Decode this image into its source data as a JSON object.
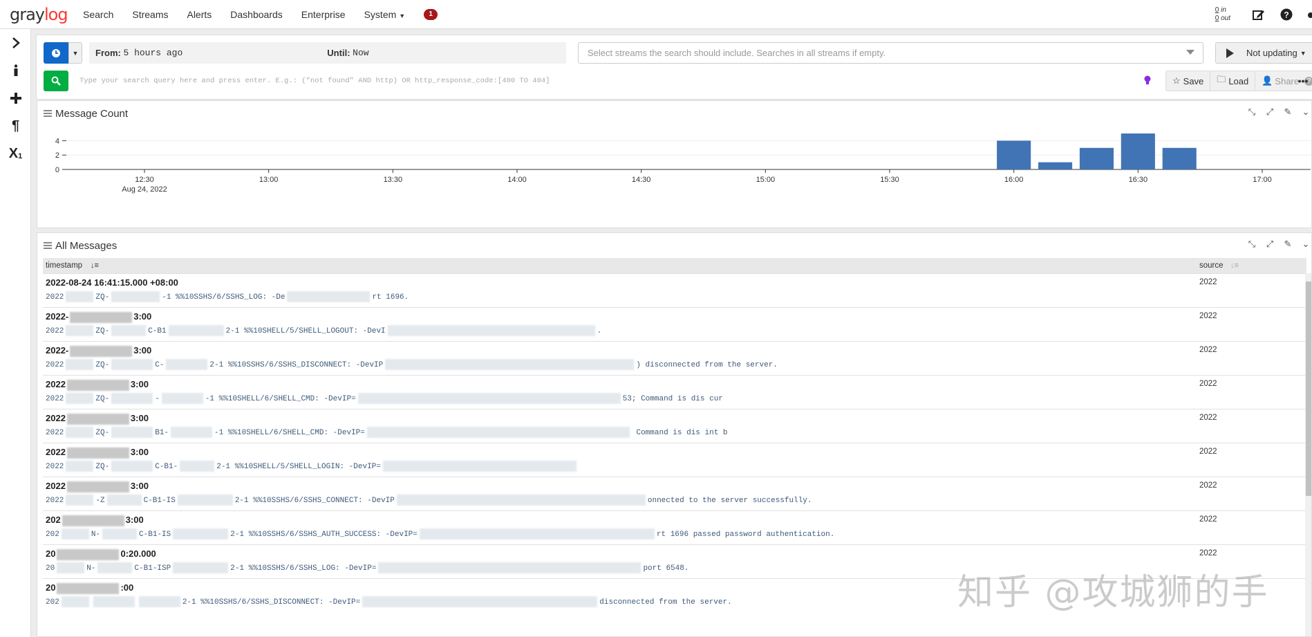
{
  "nav": {
    "logo_main": "gray",
    "logo_accent": "log",
    "items": [
      "Search",
      "Streams",
      "Alerts",
      "Dashboards",
      "Enterprise",
      "System"
    ],
    "notification_count": "1",
    "throughput_in_value": "0",
    "throughput_in_label": "in",
    "throughput_out_value": "0",
    "throughput_out_label": "out"
  },
  "search": {
    "from_label": "From",
    "from_value": "5 hours ago",
    "until_label": "Until",
    "until_value": "Now",
    "streams_placeholder": "Select streams the search should include. Searches in all streams if empty.",
    "refresh_label": "Not updating",
    "query_placeholder": "Type your search query here and press enter. E.g.: (\"not found\" AND http) OR http_response_code:[400 TO 404]",
    "save_label": "Save",
    "load_label": "Load",
    "share_label": "Share"
  },
  "message_count": {
    "title": "Message Count"
  },
  "chart_data": {
    "type": "bar",
    "ylim": [
      0,
      5
    ],
    "yticks": [
      "0",
      "2",
      "4"
    ],
    "xticks": [
      "12:30",
      "13:00",
      "13:30",
      "14:00",
      "14:30",
      "15:00",
      "15:30",
      "16:00",
      "16:30",
      "17:00"
    ],
    "x_date_label": "Aug 24, 2022",
    "bars": [
      {
        "x": "16:00",
        "value": 4
      },
      {
        "x": "16:10",
        "value": 1
      },
      {
        "x": "16:20",
        "value": 3
      },
      {
        "x": "16:30",
        "value": 5
      },
      {
        "x": "16:40",
        "value": 3
      }
    ],
    "bar_color": "#4174b4",
    "grid": true
  },
  "messages": {
    "title": "All Messages",
    "col_timestamp": "timestamp",
    "col_source": "source",
    "rows": [
      {
        "ts": "2022-08-24 16:41:15.000 +08:00",
        "ts_tail": "",
        "p1": "2022",
        "p2": "ZQ-",
        "p3": "-1 %%10SSHS/6/SSHS_LOG: -De",
        "p4": "rt 1696.",
        "source": "2022"
      },
      {
        "ts": "2022-",
        "ts_tail": "3:00",
        "p1": "2022",
        "p2": "ZQ-",
        "p3": "C-B1",
        "p4": "2-1 %%10SHELL/5/SHELL_LOGOUT: -DevI",
        "p5": ".",
        "source": "2022"
      },
      {
        "ts": "2022-",
        "ts_tail": "3:00",
        "p1": "2022",
        "p2": "ZQ-",
        "p3": "C-",
        "p4": "2-1 %%10SSHS/6/SSHS_DISCONNECT: -DevIP",
        "p5": ") disconnected from the server.",
        "source": "2022"
      },
      {
        "ts": "2022",
        "ts_tail": "3:00",
        "p1": "2022",
        "p2": "ZQ-",
        "p3": "-",
        "p4": "-1 %%10SHELL/6/SHELL_CMD: -DevIP=",
        "p5": "53; Command is dis cur",
        "source": "2022"
      },
      {
        "ts": "2022",
        "ts_tail": "3:00",
        "p1": "2022",
        "p2": "ZQ-",
        "p3": "B1-",
        "p4": "-1 %%10SHELL/6/SHELL_CMD: -DevIP=",
        "p5": " Command is dis int b",
        "source": "2022"
      },
      {
        "ts": "2022",
        "ts_tail": "3:00",
        "p1": "2022",
        "p2": "ZQ-",
        "p3": "C-B1-",
        "p4": "2-1 %%10SHELL/5/SHELL_LOGIN: -DevIP=",
        "p5": "",
        "source": "2022"
      },
      {
        "ts": "2022",
        "ts_tail": "3:00",
        "p1": "2022",
        "p2": "-Z",
        "p3": "C-B1-IS",
        "p4": "2-1 %%10SSHS/6/SSHS_CONNECT: -DevIP",
        "p5": "onnected to the server successfully.",
        "source": "2022"
      },
      {
        "ts": "202",
        "ts_tail": "3:00",
        "p1": "202",
        "p2": "N-",
        "p3": "C-B1-IS",
        "p4": "2-1 %%10SSHS/6/SSHS_AUTH_SUCCESS: -DevIP=",
        "p5": "rt 1696 passed password authentication.",
        "source": "2022"
      },
      {
        "ts": "20",
        "ts_tail": "0:20.000",
        "p1": "20",
        "p2": "N-",
        "p3": "C-B1-ISP",
        "p4": "2-1 %%10SSHS/6/SSHS_LOG: -DevIP=",
        "p5": "port 6548.",
        "source": "2022"
      },
      {
        "ts": "20",
        "ts_tail": ":00",
        "p1": "202",
        "p2": "",
        "p3": "",
        "p4": "2-1 %%10SSHS/6/SSHS_DISCONNECT: -DevIP=",
        "p5": "disconnected from the server.",
        "source": ""
      }
    ]
  },
  "watermark": "知乎 @攻城狮的手"
}
